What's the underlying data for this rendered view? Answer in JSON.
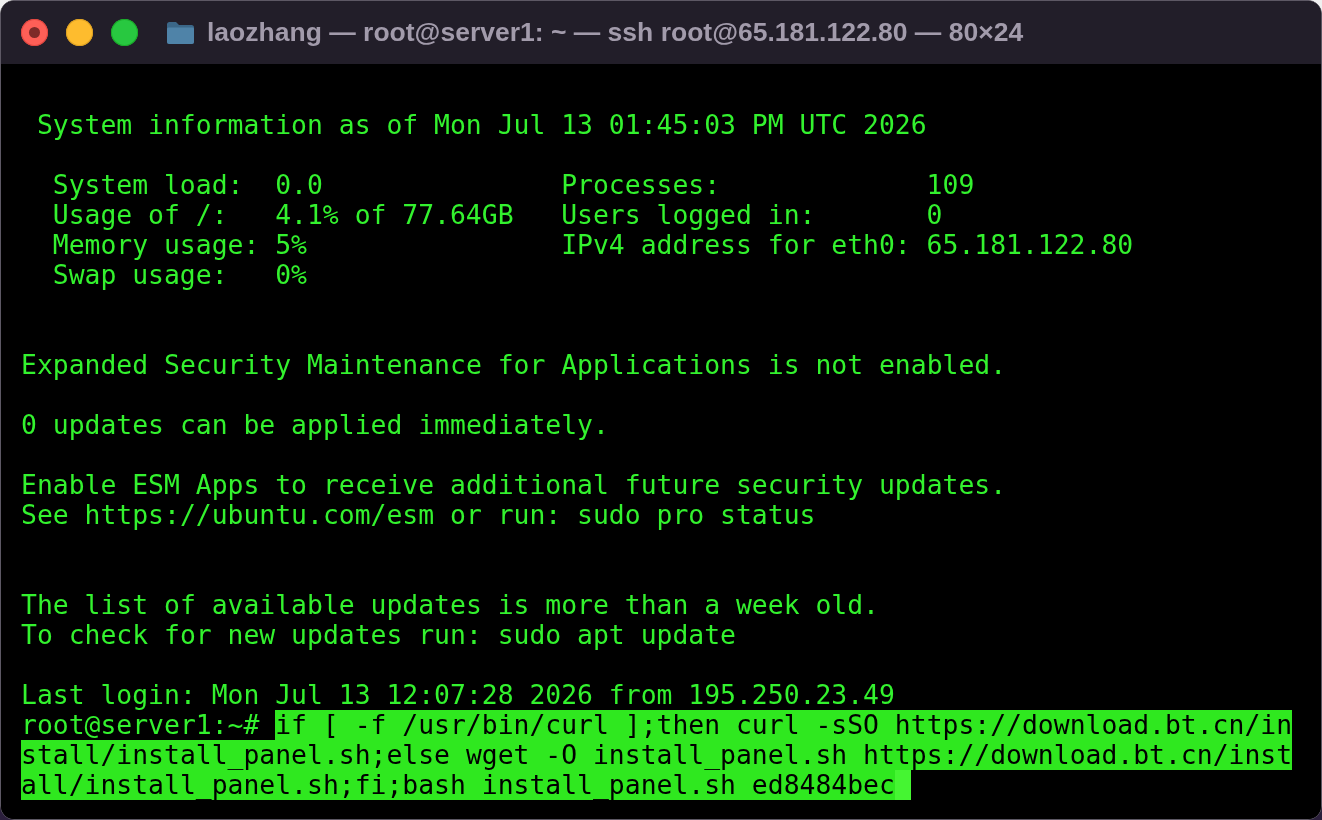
{
  "window": {
    "title": "laozhang — root@server1: ~ — ssh root@65.181.122.80 — 80×24"
  },
  "terminal": {
    "system_info": {
      "heading": "System information as of Mon Jul 13 01:45:03 PM UTC 2026",
      "rows": [
        {
          "cells": [
            {
              "label": "System load:",
              "value": "0.0"
            },
            {
              "label": "Processes:",
              "value": "109"
            }
          ]
        },
        {
          "cells": [
            {
              "label": "Usage of /:",
              "value": "4.1% of 77.64GB"
            },
            {
              "label": "Users logged in:",
              "value": "0"
            }
          ]
        },
        {
          "cells": [
            {
              "label": "Memory usage:",
              "value": "5%"
            },
            {
              "label": "IPv4 address for eth0:",
              "value": "65.181.122.80"
            }
          ]
        },
        {
          "cells": [
            {
              "label": "Swap usage:",
              "value": "0%"
            }
          ]
        }
      ]
    },
    "messages": [
      {
        "lines": [
          "Expanded Security Maintenance for Applications is not enabled."
        ]
      },
      {
        "lines": [
          "0 updates can be applied immediately."
        ]
      },
      {
        "lines": [
          "Enable ESM Apps to receive additional future security updates.",
          "See https://ubuntu.com/esm or run: sudo pro status"
        ]
      },
      {
        "lines": [
          "The list of available updates is more than a week old.",
          "To check for new updates run: sudo apt update"
        ]
      },
      {
        "lines": [
          "Last login: Mon Jul 13 12:07:28 2026 from 195.250.23.49"
        ]
      }
    ],
    "prompt": "root@server1:~#",
    "command": {
      "selected": true,
      "lines": [
        "if [ -f /usr/bin/curl ];then curl -sSO https://download.bt.cn/in",
        "stall/install_panel.sh;else wget -O install_panel.sh https://download.bt.cn/inst",
        "all/install_panel.sh;fi;bash install_panel.sh ed8484bec"
      ]
    }
  }
}
